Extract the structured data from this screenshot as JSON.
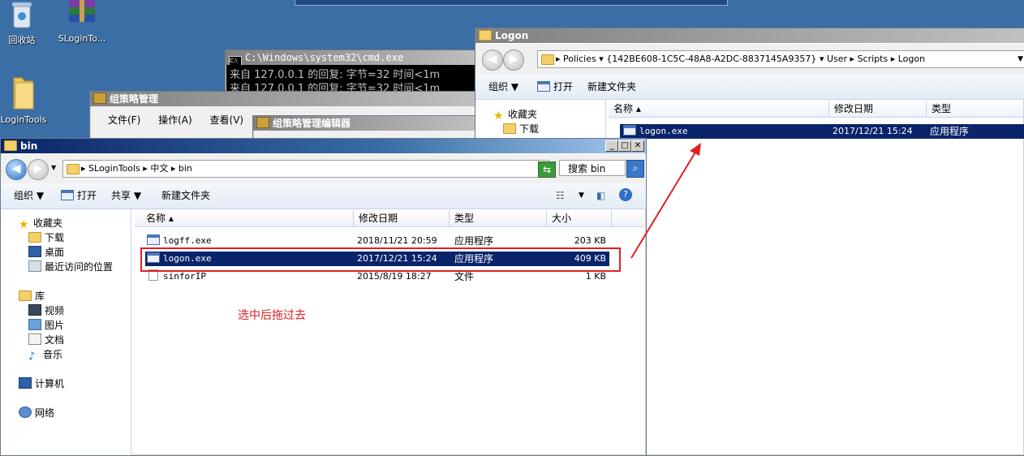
{
  "desktop": {
    "icons": [
      {
        "label": "回收站",
        "icon": "recycle-bin-icon"
      },
      {
        "label": "SLoginTo...",
        "icon": "winrar-archive-icon"
      },
      {
        "label": "LoginTools",
        "icon": "folder-icon"
      }
    ]
  },
  "cmd_window": {
    "title": "C:\\Windows\\system32\\cmd.exe",
    "lines": [
      "来自 127.0.0.1 的回复: 字节=32 时间<1m",
      "来自 127.0.0.1 的回复: 字节=32 时间<1m"
    ]
  },
  "gpm_window": {
    "title": "组策略管理",
    "menu": [
      "文件(F)",
      "操作(A)",
      "查看(V)"
    ]
  },
  "gpme_window": {
    "title": "组策略管理编辑器"
  },
  "logon_window": {
    "title": "Logon",
    "breadcrumb": [
      "Policies",
      "{142BE608-1C5C-48A8-A2DC-8837145A9357}",
      "User",
      "Scripts",
      "Logon"
    ],
    "toolbar": {
      "organize": "组织",
      "open": "打开",
      "new_folder": "新建文件夹"
    },
    "nav": {
      "favorites": "收藏夹",
      "downloads": "下载"
    },
    "columns": {
      "name": "名称",
      "date": "修改日期",
      "type": "类型"
    },
    "files": [
      {
        "name": "logon.exe",
        "date": "2017/12/21 15:24",
        "type": "应用程序"
      }
    ]
  },
  "bin_window": {
    "title": "bin",
    "breadcrumb": [
      "SLoginTools",
      "中文",
      "bin"
    ],
    "search_placeholder": "搜索 bin",
    "toolbar": {
      "organize": "组织",
      "open": "打开",
      "share": "共享",
      "new_folder": "新建文件夹"
    },
    "nav": {
      "favorites": "收藏夹",
      "downloads": "下载",
      "desktop": "桌面",
      "recent": "最近访问的位置",
      "libraries": "库",
      "videos": "视频",
      "pictures": "图片",
      "documents": "文档",
      "music": "音乐",
      "computer": "计算机",
      "network": "网络"
    },
    "columns": {
      "name": "名称",
      "date": "修改日期",
      "type": "类型",
      "size": "大小"
    },
    "files": [
      {
        "name": "logff.exe",
        "date": "2018/11/21 20:59",
        "type": "应用程序",
        "size": "203 KB"
      },
      {
        "name": "logon.exe",
        "date": "2017/12/21 15:24",
        "type": "应用程序",
        "size": "409 KB"
      },
      {
        "name": "sinforIP",
        "date": "2015/8/19 18:27",
        "type": "文件",
        "size": "1 KB"
      }
    ]
  },
  "annotation": {
    "text": "选中后拖过去",
    "color": "#e02020"
  }
}
